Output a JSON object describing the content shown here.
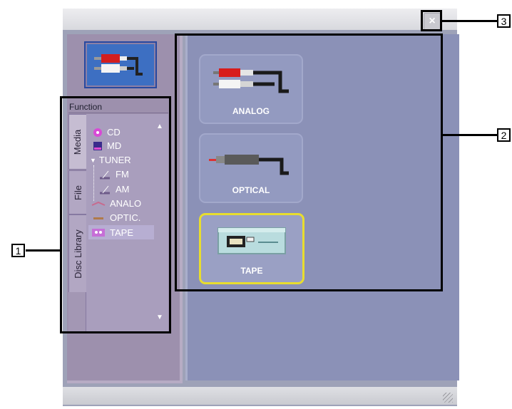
{
  "window": {
    "close_glyph": "×"
  },
  "left_panel": {
    "function_label": "Function",
    "tabs": [
      "Media",
      "File",
      "Disc Library"
    ],
    "tree": [
      {
        "label": "CD",
        "icon": "cd-icon"
      },
      {
        "label": "MD",
        "icon": "md-icon"
      },
      {
        "label": "TUNER",
        "icon": "chevron-down-icon"
      },
      {
        "label": "FM",
        "icon": "antenna-icon"
      },
      {
        "label": "AM",
        "icon": "antenna-icon"
      },
      {
        "label": "ANALO",
        "icon": "analog-cable-icon"
      },
      {
        "label": "OPTIC.",
        "icon": "optical-cable-icon"
      },
      {
        "label": "TAPE",
        "icon": "tape-icon",
        "selected": true
      }
    ]
  },
  "right_panel": {
    "buttons": [
      {
        "label": "ANALOG"
      },
      {
        "label": "OPTICAL"
      },
      {
        "label": "TAPE",
        "selected": true
      }
    ]
  },
  "callouts": [
    "1",
    "2",
    "3"
  ],
  "colors": {
    "selection_border": "#e8dd2e",
    "panel": "#8b91b7",
    "sidebar": "#9d90ad"
  }
}
